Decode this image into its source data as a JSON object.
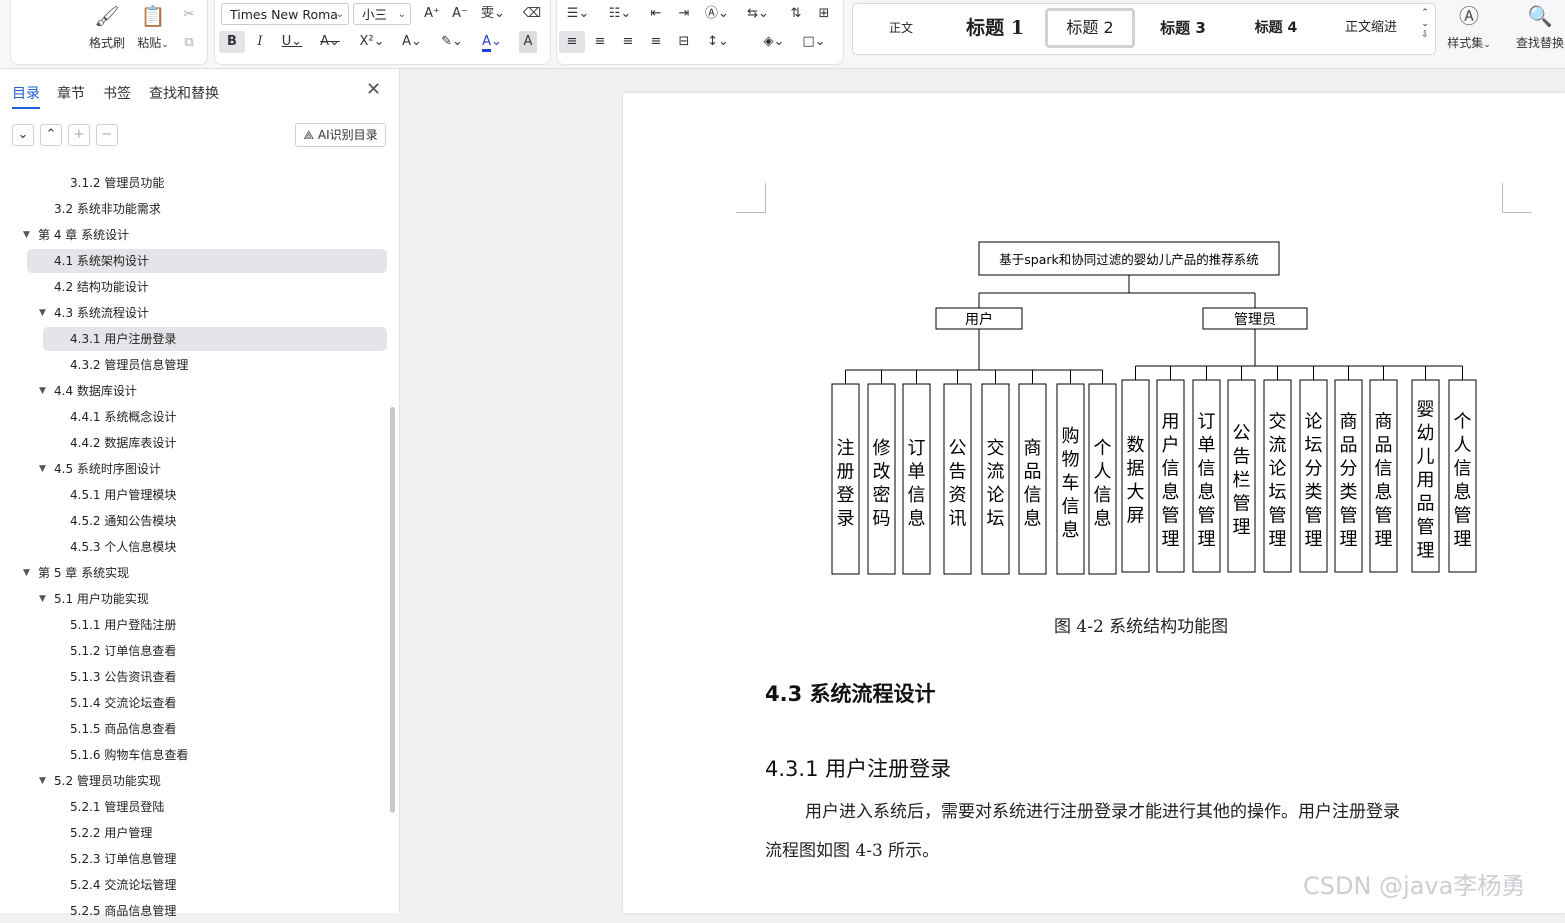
{
  "ribbon": {
    "format_painter_label": "格式刷",
    "paste_label": "粘贴",
    "font_name": "Times New Roma",
    "font_size": "小三",
    "styles": [
      "正文",
      "标题 1",
      "标题 2",
      "标题 3",
      "标题 4",
      "正文缩进"
    ],
    "selected_style": "标题 2",
    "style_set_label": "样式集",
    "find_replace_label": "查找替换"
  },
  "nav": {
    "tabs": [
      "目录",
      "章节",
      "书签",
      "查找和替换"
    ],
    "active_tab": "目录",
    "ai_button_label": "AI识别目录",
    "items": [
      {
        "label": "3.1.2  管理员功能"
      },
      {
        "label": "3.2  系统非功能需求"
      },
      {
        "label": "第 4 章  系统设计"
      },
      {
        "label": "4.1  系统架构设计"
      },
      {
        "label": "4.2  结构功能设计"
      },
      {
        "label": "4.3  系统流程设计"
      },
      {
        "label": "4.3.1  用户注册登录"
      },
      {
        "label": "4.3.2 管理员信息管理"
      },
      {
        "label": "4.4 数据库设计"
      },
      {
        "label": "4.4.1  系统概念设计"
      },
      {
        "label": "4.4.2  数据库表设计"
      },
      {
        "label": "4.5 系统时序图设计"
      },
      {
        "label": "4.5.1  用户管理模块"
      },
      {
        "label": "4.5.2  通知公告模块"
      },
      {
        "label": "4.5.3  个人信息模块"
      },
      {
        "label": "第 5 章  系统实现"
      },
      {
        "label": "5.1  用户功能实现"
      },
      {
        "label": "5.1.1  用户登陆注册"
      },
      {
        "label": "5.1.2  订单信息查看"
      },
      {
        "label": "5.1.3  公告资讯查看"
      },
      {
        "label": "5.1.4  交流论坛查看"
      },
      {
        "label": "5.1.5  商品信息查看"
      },
      {
        "label": "5.1.6  购物车信息查看"
      },
      {
        "label": "5.2  管理员功能实现"
      },
      {
        "label": "5.2.1 管理员登陆"
      },
      {
        "label": "5.2.2 用户管理"
      },
      {
        "label": "5.2.3  订单信息管理"
      },
      {
        "label": "5.2.4  交流论坛管理"
      },
      {
        "label": "5.2.5  商品信息管理"
      }
    ]
  },
  "document": {
    "diagram": {
      "root": "基于spark和协同过滤的婴幼儿产品的推荐系统",
      "user_group": "用户",
      "admin_group": "管理员",
      "user_modules": [
        "注册登录",
        "修改密码",
        "订单信息",
        "公告资讯",
        "交流论坛",
        "商品信息",
        "购物车信息",
        "个人信息"
      ],
      "admin_modules": [
        "数据大屏",
        "用户信息管理",
        "订单信息管理",
        "公告栏管理",
        "交流论坛管理",
        "论坛分类管理",
        "商品分类管理",
        "商品信息管理",
        "婴幼儿用品管理",
        "个人信息管理"
      ]
    },
    "figure_caption": "图 4-2 系统结构功能图",
    "section_heading": "4.3  系统流程设计",
    "subsection_heading": "4.3.1  用户注册登录",
    "paragraph_line1": "用户进入系统后，需要对系统进行注册登录才能进行其他的操作。用户注册登录",
    "paragraph_line2": "流程图如图 4-3 所示。"
  },
  "watermark": "CSDN @java李杨勇"
}
